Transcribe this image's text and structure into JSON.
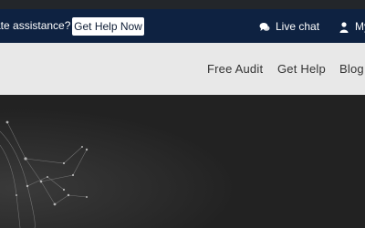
{
  "top_bar": {
    "assist_text": "ate assistance?",
    "help_button": "Get Help Now",
    "live_chat": "Live chat",
    "account": "My"
  },
  "nav": {
    "items": [
      "Free Audit",
      "Get Help",
      "Blog"
    ]
  },
  "icons": {
    "live_chat": "chat-bubbles-icon",
    "account": "user-icon"
  },
  "colors": {
    "top_bar_bg": "#0e2241",
    "nav_bg": "#e8e8e8",
    "hero_bg": "#222222"
  }
}
